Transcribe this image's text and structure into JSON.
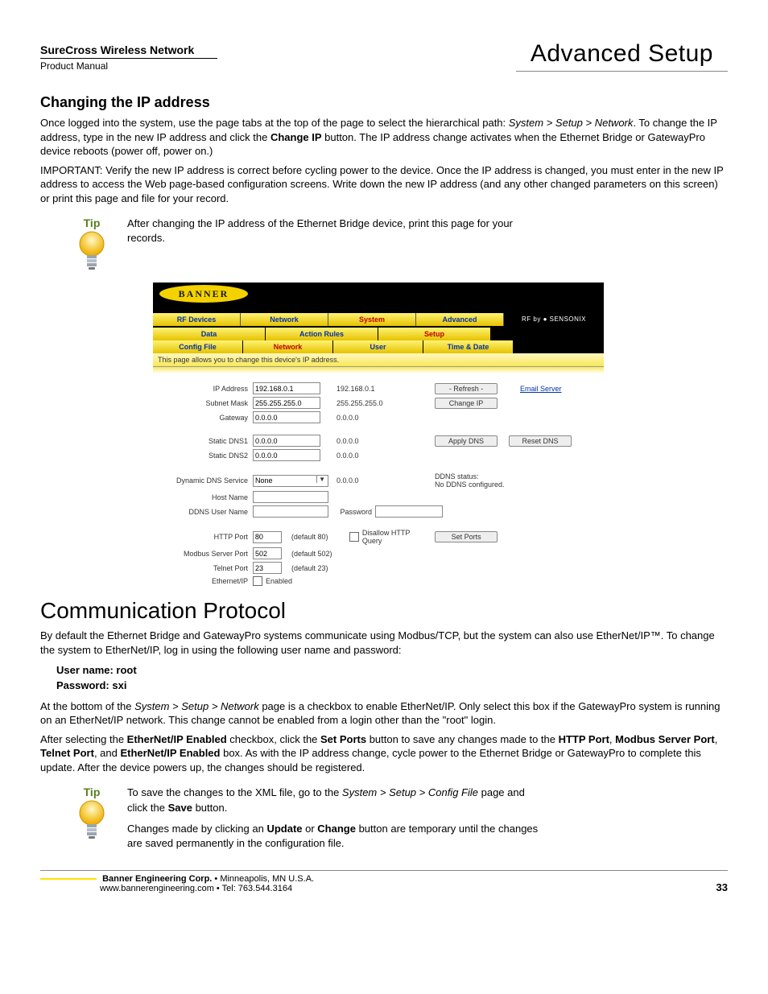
{
  "header": {
    "left_title": "SureCross Wireless Network",
    "left_sub": "Product Manual",
    "right_title": "Advanced Setup"
  },
  "section1": {
    "heading": "Changing the IP address",
    "p1a": "Once logged into the system, use the page tabs at the top of the page to select the hierarchical path: ",
    "p1b": "System > Setup > Network",
    "p1c": ".  To change the IP address, type in the new IP address and click the ",
    "p1d": "Change IP",
    "p1e": " button. The IP address change activates when the Ethernet Bridge or GatewayPro device reboots (power off, power on.)",
    "p2": "IMPORTANT: Verify the new IP address is correct before cycling power to the device. Once the IP address is changed, you must enter in the new IP address to access the Web page-based configuration screens. Write down the new IP address (and any other changed parameters on this screen) or print this page and file for your record."
  },
  "tip1": {
    "label": "Tip",
    "text": "After changing the IP address of the Ethernet Bridge device, print this page for your records."
  },
  "shot": {
    "tabs1": [
      "RF Devices",
      "Network",
      "System",
      "Advanced"
    ],
    "brand": "RF by ● SENSONIX",
    "tabs2": [
      "Data",
      "Action Rules",
      "Setup",
      ""
    ],
    "tabs3": [
      "Config File",
      "Network",
      "User",
      "Time & Date",
      ""
    ],
    "info": "This page allows you to change this device's IP address.",
    "rows": {
      "ip_label": "IP Address",
      "ip_val": "192.168.0.1",
      "ip_cur": "192.168.0.1",
      "mask_label": "Subnet Mask",
      "mask_val": "255.255.255.0",
      "mask_cur": "255.255.255.0",
      "gw_label": "Gateway",
      "gw_val": "0.0.0.0",
      "gw_cur": "0.0.0.0",
      "dns1_label": "Static DNS1",
      "dns1_val": "0.0.0.0",
      "dns1_cur": "0.0.0.0",
      "dns2_label": "Static DNS2",
      "dns2_val": "0.0.0.0",
      "dns2_cur": "0.0.0.0",
      "ddns_label": "Dynamic DNS Service",
      "ddns_val": "None",
      "ddns_cur": "0.0.0.0",
      "host_label": "Host Name",
      "ddnsu_label": "DDNS User Name",
      "pwd_label": "Password",
      "http_label": "HTTP Port",
      "http_val": "80",
      "http_def": "(default 80)",
      "disallow": "Disallow HTTP Query",
      "modbus_label": "Modbus Server Port",
      "modbus_val": "502",
      "modbus_def": "(default 502)",
      "telnet_label": "Telnet Port",
      "telnet_val": "23",
      "telnet_def": "(default 23)",
      "eip_label": "Ethernet/IP",
      "eip_enabled": "Enabled",
      "ddns_status_a": "DDNS status:",
      "ddns_status_b": "No DDNS configured."
    },
    "buttons": {
      "refresh": "- Refresh -",
      "changeip": "Change IP",
      "applydns": "Apply DNS",
      "resetdns": "Reset DNS",
      "setports": "Set Ports",
      "email": "Email Server"
    }
  },
  "section2": {
    "heading": "Communication Protocol",
    "p1": "By default the Ethernet Bridge and GatewayPro systems communicate using Modbus/TCP, but the system can also use EtherNet/IP™. To change the system to EtherNet/IP, log in using the following user name and password:",
    "creds_user": "User name: root",
    "creds_pwd": "Password: sxi",
    "p2a": "At the bottom of the ",
    "p2b": "System > Setup > Network",
    "p2c": " page is a checkbox to enable EtherNet/IP. Only select this box if the GatewayPro system is running on an EtherNet/IP network. This change cannot be enabled from a login other than the \"root\" login.",
    "p3a": "After selecting the ",
    "p3b": "EtherNet/IP Enabled",
    "p3c": " checkbox, click the ",
    "p3d": "Set Ports",
    "p3e": " button to save any changes made to the ",
    "p3f": "HTTP Port",
    "p3g": ", ",
    "p3h": "Modbus Server Port",
    "p3i": ", ",
    "p3j": "Telnet Port",
    "p3k": ", and ",
    "p3l": "EtherNet/IP Enabled",
    "p3m": " box. As with the IP address change, cycle power to the Ethernet Bridge or GatewayPro to complete this update. After the device powers up, the changes should be registered."
  },
  "tip2": {
    "label": "Tip",
    "t1a": "To save the changes to the XML file, go to the ",
    "t1b": "System > Setup > Config File",
    "t1c": " page and click the ",
    "t1d": "Save",
    "t1e": " button.",
    "t2a": "Changes made by clicking an ",
    "t2b": "Update",
    "t2c": " or ",
    "t2d": "Change",
    "t2e": " button are temporary until the changes are saved permanently in the configuration file."
  },
  "footer": {
    "line1a": "Banner Engineering Corp.",
    "line1b": " • Minneapolis, MN U.S.A.",
    "line2": "www.bannerengineering.com  •  Tel: 763.544.3164",
    "page": "33"
  }
}
